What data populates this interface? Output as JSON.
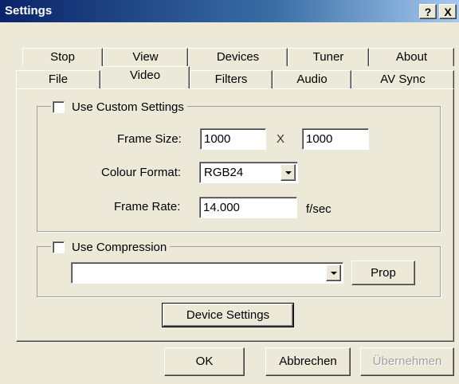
{
  "window": {
    "title": "Settings",
    "help_glyph": "?",
    "close_glyph": "X"
  },
  "tabs": {
    "row1": [
      "Stop",
      "View",
      "Devices",
      "Tuner",
      "About"
    ],
    "row2": [
      "File",
      "Video",
      "Filters",
      "Audio",
      "AV Sync"
    ],
    "active": "Video"
  },
  "custom_settings": {
    "label": "Use Custom Settings",
    "checked": false,
    "frame_size_label": "Frame Size:",
    "frame_width": "1000",
    "times_glyph": "X",
    "frame_height": "1000",
    "colour_format_label": "Colour Format:",
    "colour_format_value": "RGB24",
    "frame_rate_label": "Frame Rate:",
    "frame_rate_value": "14.000",
    "frame_rate_unit": "f/sec"
  },
  "compression": {
    "label": "Use Compression",
    "checked": false,
    "codec_value": "",
    "prop_button": "Prop"
  },
  "device_settings_button": "Device Settings",
  "footer": {
    "ok": "OK",
    "cancel": "Abbrechen",
    "apply": "Übernehmen",
    "apply_enabled": false
  }
}
